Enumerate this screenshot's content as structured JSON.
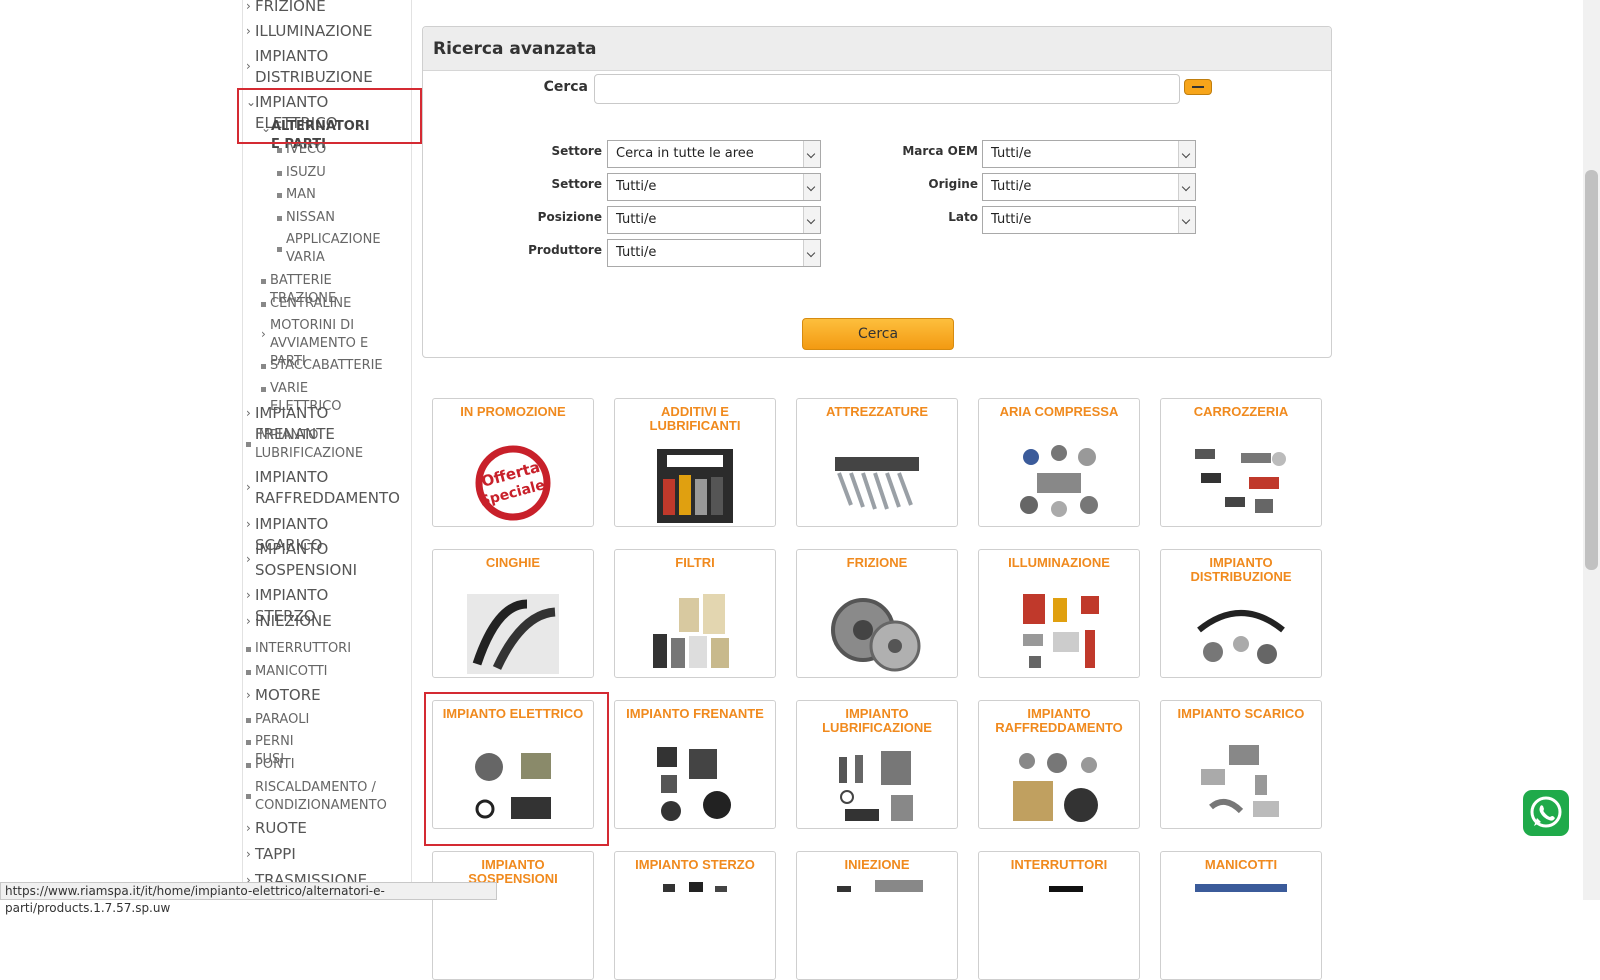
{
  "sidebar": {
    "items": [
      {
        "label": "FRIZIONE",
        "marker": "chevron-right"
      },
      {
        "label": "ILLUMINAZIONE",
        "marker": "chevron-right"
      },
      {
        "label": "IMPIANTO DISTRIBUZIONE",
        "marker": "chevron-right"
      },
      {
        "label": "IMPIANTO ELETTRICO",
        "marker": "chevron-down"
      },
      {
        "label": "ALTERNATORI E PARTI",
        "marker": "chevron-down"
      },
      {
        "label": "IVECO",
        "marker": "square"
      },
      {
        "label": "ISUZU",
        "marker": "square"
      },
      {
        "label": "MAN",
        "marker": "square"
      },
      {
        "label": "NISSAN",
        "marker": "square"
      },
      {
        "label": "APPLICAZIONE VARIA",
        "marker": "square"
      },
      {
        "label": "BATTERIE TRAZIONE",
        "marker": "square"
      },
      {
        "label": "CENTRALINE",
        "marker": "square"
      },
      {
        "label": "MOTORINI DI AVVIAMENTO E PARTI",
        "marker": "chevron-right"
      },
      {
        "label": "STACCABATTERIE",
        "marker": "square"
      },
      {
        "label": "VARIE ELETTRICO",
        "marker": "square"
      },
      {
        "label": "IMPIANTO FRENANTE",
        "marker": "chevron-right"
      },
      {
        "label": "IMPIANTO LUBRIFICAZIONE",
        "marker": "square"
      },
      {
        "label": "IMPIANTO RAFFREDDAMENTO",
        "marker": "chevron-right"
      },
      {
        "label": "IMPIANTO SCARICO",
        "marker": "chevron-right"
      },
      {
        "label": "IMPIANTO SOSPENSIONI",
        "marker": "chevron-right"
      },
      {
        "label": "IMPIANTO STERZO",
        "marker": "chevron-right"
      },
      {
        "label": "INIEZIONE",
        "marker": "chevron-right"
      },
      {
        "label": "INTERRUTTORI",
        "marker": "square"
      },
      {
        "label": "MANICOTTI",
        "marker": "square"
      },
      {
        "label": "MOTORE",
        "marker": "chevron-right"
      },
      {
        "label": "PARAOLI",
        "marker": "square"
      },
      {
        "label": "PERNI FUSI",
        "marker": "square"
      },
      {
        "label": "PONTI",
        "marker": "square"
      },
      {
        "label": "RISCALDAMENTO / CONDIZIONAMENTO",
        "marker": "square"
      },
      {
        "label": "RUOTE",
        "marker": "chevron-right"
      },
      {
        "label": "TAPPI",
        "marker": "chevron-right"
      },
      {
        "label": "TRASMISSIONE",
        "marker": "chevron-right"
      }
    ]
  },
  "search_panel": {
    "title": "Ricerca avanzata",
    "cerca_label": "Cerca",
    "search_value": "",
    "fields_left": [
      {
        "label": "Settore",
        "value": "Cerca in tutte le aree"
      },
      {
        "label": "Settore",
        "value": "Tutti/e"
      },
      {
        "label": "Posizione",
        "value": "Tutti/e"
      },
      {
        "label": "Produttore",
        "value": "Tutti/e"
      }
    ],
    "fields_right": [
      {
        "label": "Marca OEM",
        "value": "Tutti/e"
      },
      {
        "label": "Origine",
        "value": "Tutti/e"
      },
      {
        "label": "Lato",
        "value": "Tutti/e"
      }
    ],
    "submit_label": "Cerca"
  },
  "categories": [
    {
      "title": "IN PROMOZIONE",
      "icon": "offerta-speciale-badge"
    },
    {
      "title": "ADDITIVI E LUBRIFICANTI",
      "icon": "lubricant-products-image"
    },
    {
      "title": "ATTREZZATURE",
      "icon": "wrench-set-image"
    },
    {
      "title": "ARIA COMPRESSA",
      "icon": "air-compressor-parts-image"
    },
    {
      "title": "CARROZZERIA",
      "icon": "body-parts-image"
    },
    {
      "title": "CINGHIE",
      "icon": "belts-image"
    },
    {
      "title": "FILTRI",
      "icon": "filters-image"
    },
    {
      "title": "FRIZIONE",
      "icon": "clutch-image"
    },
    {
      "title": "ILLUMINAZIONE",
      "icon": "lights-image"
    },
    {
      "title": "IMPIANTO DISTRIBUZIONE",
      "icon": "timing-kit-image"
    },
    {
      "title": "IMPIANTO ELETTRICO",
      "icon": "electrical-parts-image"
    },
    {
      "title": "IMPIANTO FRENANTE",
      "icon": "brake-parts-image"
    },
    {
      "title": "IMPIANTO LUBRIFICAZIONE",
      "icon": "oil-pump-image"
    },
    {
      "title": "IMPIANTO RAFFREDDAMENTO",
      "icon": "radiator-image"
    },
    {
      "title": "IMPIANTO SCARICO",
      "icon": "exhaust-image"
    },
    {
      "title": "IMPIANTO SOSPENSIONI",
      "icon": "suspension-image"
    },
    {
      "title": "IMPIANTO STERZO",
      "icon": "steering-image"
    },
    {
      "title": "INIEZIONE",
      "icon": "injection-image"
    },
    {
      "title": "INTERRUTTORI",
      "icon": "switches-image"
    },
    {
      "title": "MANICOTTI",
      "icon": "hoses-image"
    }
  ],
  "status_bar": {
    "url": "https://www.riamspa.it/it/home/impianto-elettrico/alternatori-e-parti/products.1.7.57.sp.uw"
  },
  "colors": {
    "accent": "#f08a1e",
    "highlight": "#d42a32",
    "button": "#f7a51a",
    "whatsapp": "#1faa4a"
  }
}
